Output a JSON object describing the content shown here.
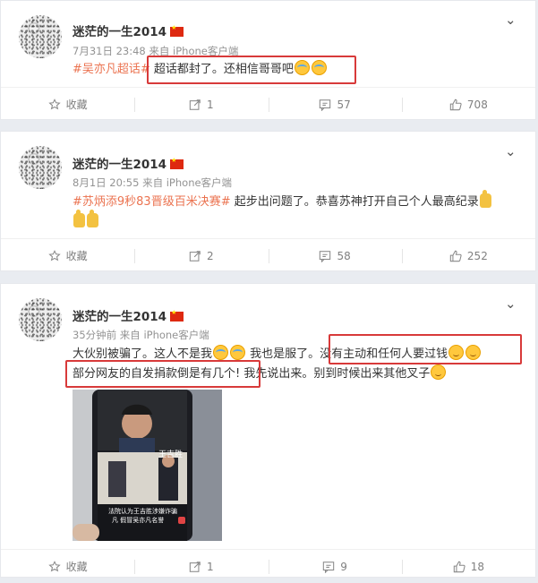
{
  "posts": [
    {
      "username": "迷茫的一生2014",
      "meta": "7月31日 23:48 来自 iPhone客户端",
      "tag": "#吴亦凡超话#",
      "text": " 超话都封了。还相信哥哥吧",
      "emojis": [
        "cry",
        "cry"
      ],
      "actions": {
        "favorite": "收藏",
        "repost": "1",
        "comment": "57",
        "like": "708"
      }
    },
    {
      "username": "迷茫的一生2014",
      "meta": "8月1日 20:55 来自 iPhone客户端",
      "tag": "#苏炳添9秒83晋级百米决赛#",
      "text": " 起步出问题了。恭喜苏神打开自己个人最高纪录",
      "emojis": [
        "thumb",
        "thumb",
        "thumb"
      ],
      "actions": {
        "favorite": "收藏",
        "repost": "2",
        "comment": "58",
        "like": "252"
      }
    },
    {
      "username": "迷茫的一生2014",
      "meta": "35分钟前 来自 iPhone客户端",
      "line1a": "大伙别被骗了。这人不是我",
      "line1b": " 我也是服了。",
      "line1c": "没有主动和任何人要过钱",
      "line2a": "部分网友的自发捐款倒是有几个!",
      "line2b": "我先说出来。别到时候出来其他叉子",
      "image": {
        "name_caption": "王吉胜",
        "subtitle1": "法院认为王吉胜涉嫌诈骗",
        "subtitle2": "凡 假冒吴亦凡名誉"
      },
      "actions": {
        "favorite": "收藏",
        "repost": "1",
        "comment": "9",
        "like": "18"
      }
    }
  ],
  "colors": {
    "tag": "#eb7350",
    "highlight_box": "#d83a3a",
    "verified_flag": "#de2910"
  }
}
